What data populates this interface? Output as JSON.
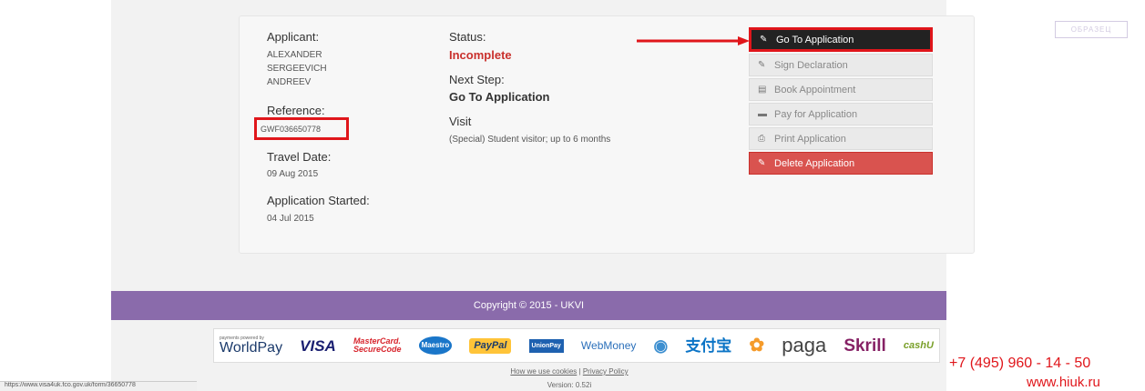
{
  "applicant": {
    "label": "Applicant:",
    "name_line1": "ALEXANDER",
    "name_line2": "SERGEEVICH",
    "name_line3": "ANDREEV"
  },
  "reference": {
    "label": "Reference:",
    "value": "GWF036650778"
  },
  "travel": {
    "label": "Travel Date:",
    "value": "09 Aug 2015"
  },
  "started": {
    "label": "Application Started:",
    "value": "04 Jul 2015"
  },
  "status": {
    "label": "Status:",
    "value": "Incomplete"
  },
  "next_step": {
    "label": "Next Step:",
    "value": "Go To Application"
  },
  "visit": {
    "label": "Visit",
    "value": "(Special) Student visitor; up to 6 months"
  },
  "actions": [
    {
      "label": "Go To Application",
      "icon": "pencil-icon"
    },
    {
      "label": "Sign Declaration",
      "icon": "pencil-icon"
    },
    {
      "label": "Book Appointment",
      "icon": "list-icon"
    },
    {
      "label": "Pay for Application",
      "icon": "card-icon"
    },
    {
      "label": "Print Application",
      "icon": "printer-icon"
    },
    {
      "label": "Delete Application",
      "icon": "pencil-icon"
    }
  ],
  "footer": {
    "copyright": "Copyright © 2015 - UKVI",
    "cookies_link": "How we use cookies",
    "privacy_link": "Privacy Policy",
    "separator": "|",
    "version": "Version: 0.52i"
  },
  "payment_logos": {
    "powered_by": "payments powered by",
    "worldpay": "WorldPay",
    "visa": "VISA",
    "mastercard": "MasterCard.",
    "securecode": "SecureCode",
    "maestro": "Maestro",
    "paypal": "PayPal",
    "unionpay": "UnionPay",
    "webmoney": "WebMoney",
    "alipay": "支付宝",
    "paga": "paga",
    "skrill": "Skrill",
    "cashu": "cashU"
  },
  "status_bar_url": "https://www.visa4uk.fco.gov.uk/form/36650778",
  "watermark": {
    "phone": "+7 (495) 960 - 14 - 50",
    "site": "www.hiuk.ru",
    "stamp": "ОБРАЗЕЦ"
  },
  "colors": {
    "accent_red": "#e0161b",
    "footer_purple": "#8a6bab",
    "danger": "#d9534f"
  }
}
